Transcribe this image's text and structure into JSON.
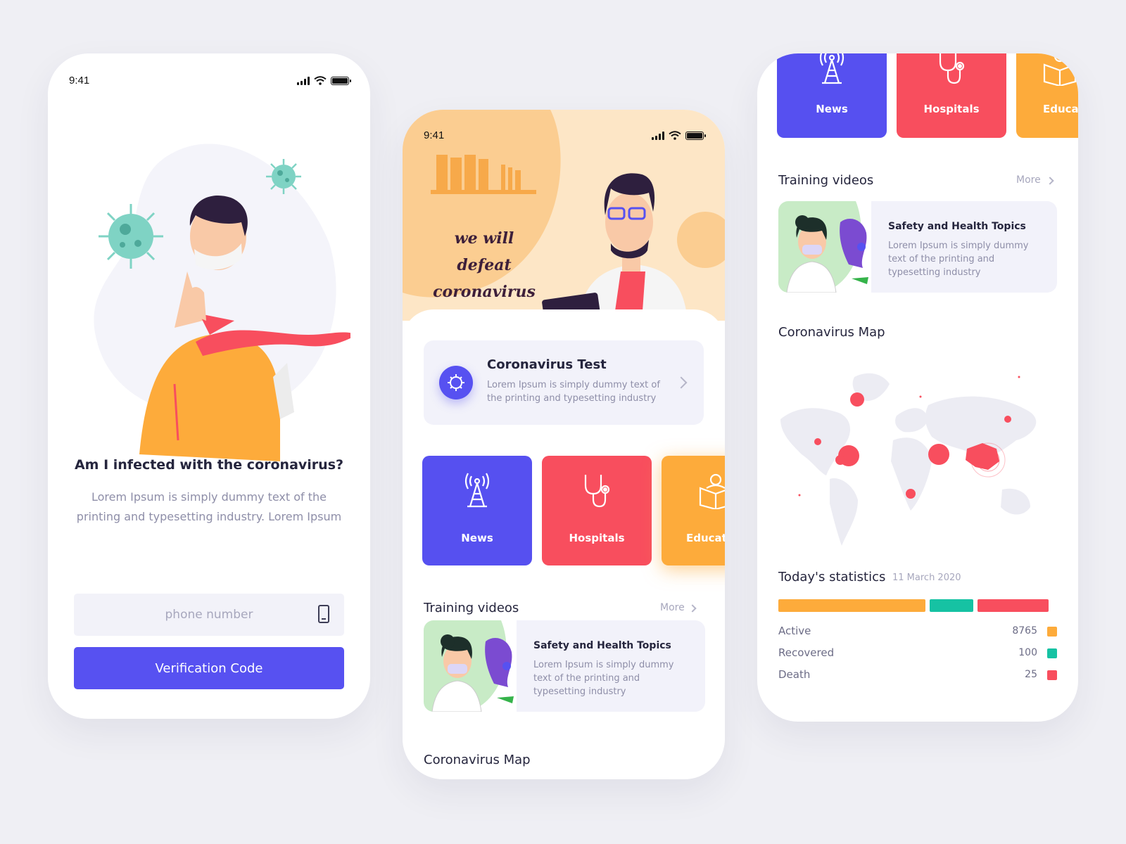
{
  "status": {
    "time": "9:41"
  },
  "login": {
    "question": "Am I infected with the coronavirus?",
    "description": "Lorem Ipsum is simply dummy text of the printing and typesetting industry. Lorem Ipsum",
    "phone_placeholder": "phone number",
    "verify_label": "Verification Code"
  },
  "home": {
    "hero_title": "we will defeat coronavirus",
    "test_card": {
      "title": "Coronavirus Test",
      "description": "Lorem Ipsum is simply dummy text of the printing and typesetting industry"
    },
    "categories": [
      {
        "label": "News",
        "color": "#5650f0",
        "icon": "radio-tower-icon"
      },
      {
        "label": "Hospitals",
        "color": "#f84e5e",
        "icon": "stethoscope-icon"
      },
      {
        "label": "Education",
        "color": "#fdab3b",
        "icon": "reading-icon"
      }
    ],
    "training_title": "Training videos",
    "more_label": "More",
    "video": {
      "title": "Safety and Health Topics",
      "description": "Lorem Ipsum is simply dummy text of the printing and typesetting industry"
    },
    "map_title": "Coronavirus Map"
  },
  "detail": {
    "categories": [
      "News",
      "Hospitals",
      "Educa"
    ],
    "training_title": "Training videos",
    "more_label": "More",
    "video": {
      "title": "Safety and Health Topics",
      "description": "Lorem Ipsum is simply dummy text of the printing and typesetting industry"
    },
    "map_title": "Coronavirus Map",
    "stats": {
      "title": "Today's statistics",
      "date": "11 March 2020",
      "rows": [
        {
          "label": "Active",
          "value": "8765",
          "color": "#fdab3b"
        },
        {
          "label": "Recovered",
          "value": "100",
          "color": "#16c2a3"
        },
        {
          "label": "Death",
          "value": "25",
          "color": "#f84e5e"
        }
      ],
      "bar_fractions": [
        0.545,
        0.16,
        0.265
      ]
    }
  },
  "colors": {
    "primary": "#5751f1",
    "red": "#f84e5e",
    "orange": "#fdab3b",
    "teal": "#16c2a3"
  }
}
